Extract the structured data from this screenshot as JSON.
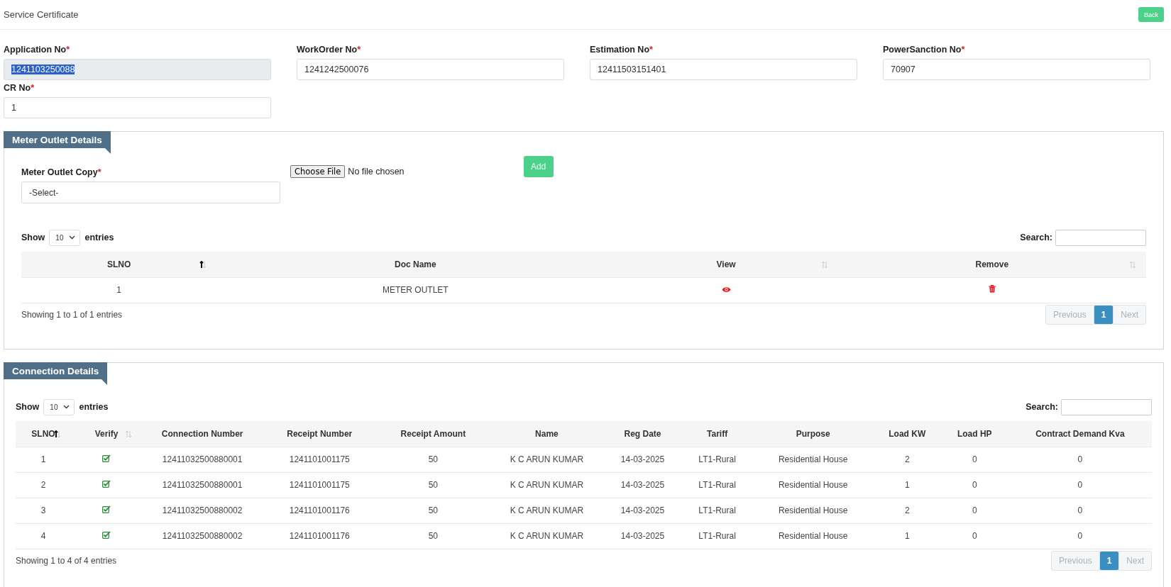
{
  "header": {
    "title": "Service Certificate",
    "back_button": "Back"
  },
  "fields": [
    {
      "label": "Application No",
      "required_mark": "*",
      "value": "1241103250088",
      "readonly": true,
      "text_selected": true
    },
    {
      "label": "WorkOrder No",
      "required_mark": "*",
      "value": "1241242500076",
      "readonly": false,
      "text_selected": false
    },
    {
      "label": "Estimation No",
      "required_mark": "*",
      "value": "12411503151401",
      "readonly": false,
      "text_selected": false
    },
    {
      "label": "PowerSanction No",
      "required_mark": "*",
      "value": "70907",
      "readonly": false,
      "text_selected": false
    },
    {
      "label": "CR No",
      "required_mark": "*",
      "value": "1",
      "readonly": false,
      "text_selected": false
    }
  ],
  "meter_outlet": {
    "title": "Meter Outlet Details",
    "copy_label": "Meter Outlet Copy",
    "required_mark": "*",
    "select_value": "-Select-",
    "file_button": "Choose File",
    "file_status": "No file chosen",
    "add_button": "Add",
    "table": {
      "show_label": "Show",
      "page_size": "10",
      "entries_label": "entries",
      "search_label": "Search:",
      "columns": [
        {
          "label": "SLNO",
          "sortable": true,
          "sorted": true
        },
        {
          "label": "Doc Name",
          "sortable": false
        },
        {
          "label": "View",
          "sortable": true,
          "sorted": false
        },
        {
          "label": "Remove",
          "sortable": true,
          "sorted": false
        }
      ],
      "rows": [
        [
          "1",
          "METER OUTLET",
          {
            "kind": "view"
          },
          {
            "kind": "remove"
          }
        ]
      ],
      "info": "Showing 1 to 1 of 1 entries",
      "previous": {
        "label": "Previous",
        "disabled": true
      },
      "pages": [
        {
          "label": "1",
          "selected": true
        }
      ],
      "next": {
        "label": "Next",
        "disabled": true
      }
    }
  },
  "connection": {
    "title": "Connection Details",
    "table": {
      "show_label": "Show",
      "page_size": "10",
      "entries_label": "entries",
      "search_label": "Search:",
      "columns": [
        {
          "label": "SLNO",
          "sortable": true,
          "sorted": true
        },
        {
          "label": "Verify",
          "sortable": true,
          "sorted": false
        },
        {
          "label": "Connection Number",
          "sortable": false
        },
        {
          "label": "Receipt Number",
          "sortable": false
        },
        {
          "label": "Receipt Amount",
          "sortable": false
        },
        {
          "label": "Name",
          "sortable": false
        },
        {
          "label": "Reg Date",
          "sortable": false
        },
        {
          "label": "Tariff",
          "sortable": false
        },
        {
          "label": "Purpose",
          "sortable": false
        },
        {
          "label": "Load KW",
          "sortable": false
        },
        {
          "label": "Load HP",
          "sortable": false
        },
        {
          "label": "Contract Demand Kva",
          "sortable": false
        }
      ],
      "rows": [
        [
          "1",
          {
            "kind": "verify",
            "checked": true
          },
          "12411032500880001",
          "1241101001175",
          "50",
          "K C ARUN KUMAR",
          "14-03-2025",
          "LT1-Rural",
          "Residential House",
          "2",
          "0",
          "0"
        ],
        [
          "2",
          {
            "kind": "verify",
            "checked": true
          },
          "12411032500880001",
          "1241101001175",
          "50",
          "K C ARUN KUMAR",
          "14-03-2025",
          "LT1-Rural",
          "Residential House",
          "1",
          "0",
          "0"
        ],
        [
          "3",
          {
            "kind": "verify",
            "checked": true
          },
          "12411032500880002",
          "1241101001176",
          "50",
          "K C ARUN KUMAR",
          "14-03-2025",
          "LT1-Rural",
          "Residential House",
          "2",
          "0",
          "0"
        ],
        [
          "4",
          {
            "kind": "verify",
            "checked": true
          },
          "12411032500880002",
          "1241101001176",
          "50",
          "K C ARUN KUMAR",
          "14-03-2025",
          "LT1-Rural",
          "Residential House",
          "1",
          "0",
          "0"
        ]
      ],
      "info": "Showing 1 to 4 of 4 entries",
      "previous": {
        "label": "Previous",
        "disabled": true
      },
      "pages": [
        {
          "label": "1",
          "selected": true
        }
      ],
      "next": {
        "label": "Next",
        "disabled": true
      }
    }
  }
}
